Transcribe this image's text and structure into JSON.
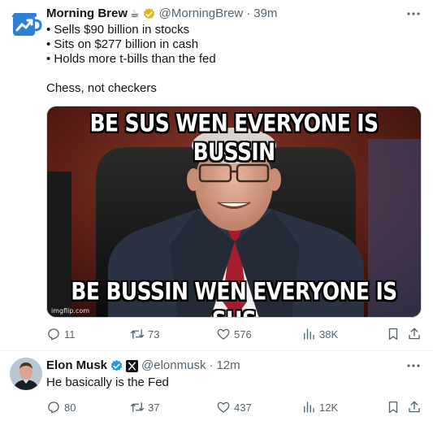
{
  "tweets": [
    {
      "author": {
        "display_name": "Morning Brew",
        "emoji": "☕",
        "handle": "@MorningBrew",
        "verified_badge": "gold-check-icon"
      },
      "time": "39m",
      "separator": "·",
      "lines": [
        "• Sells $90 billion in stocks",
        "• Sits on $277 billion in cash",
        "• Holds more t-bills than the fed",
        "",
        "Chess, not checkers"
      ],
      "media": {
        "top_text": "BE SUS WEN EVERYONE IS BUSSIN",
        "bottom_text": "BE BUSSIN WEN EVERYONE IS SUS",
        "watermark": "imgflip.com"
      },
      "stats": {
        "replies": "11",
        "retweets": "73",
        "likes": "576",
        "views": "38K"
      }
    },
    {
      "author": {
        "display_name": "Elon Musk",
        "handle": "@elonmusk",
        "verified_badge": "blue-check-icon",
        "affiliate_badge": "x-logo-icon"
      },
      "time": "12m",
      "separator": "·",
      "lines": [
        "He basically is the Fed"
      ],
      "stats": {
        "replies": "80",
        "retweets": "37",
        "likes": "437",
        "views": "12K"
      }
    }
  ],
  "colors": {
    "text": "#0f1419",
    "muted": "#536471",
    "verified_blue": "#1d9bf0",
    "verified_gold": "#e2b719",
    "brand_blue": "#2f7fd6",
    "divider": "#eff3f4"
  },
  "icons": [
    "more-icon",
    "reply-icon",
    "retweet-icon",
    "like-icon",
    "views-icon",
    "bookmark-icon",
    "share-icon"
  ]
}
